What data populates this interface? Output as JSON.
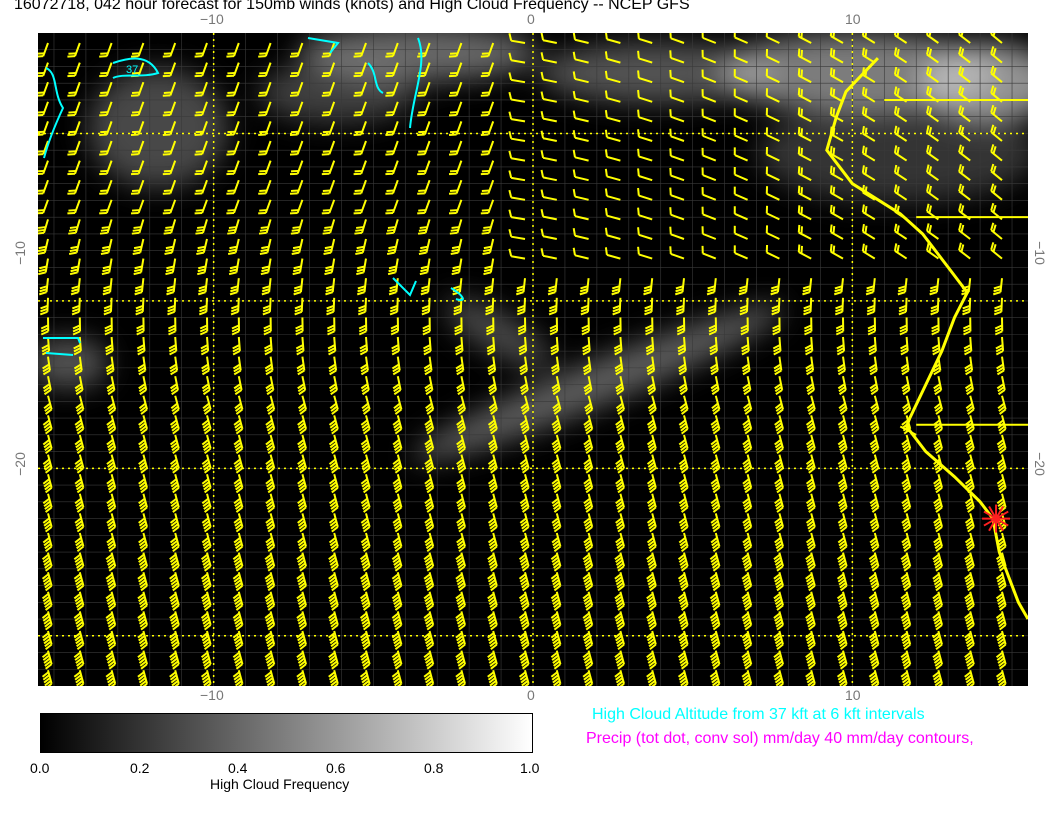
{
  "title": "16072718, 042 hour forecast for 150mb winds (knots) and High Cloud Frequency -- NCEP GFS",
  "map": {
    "lon_range": [
      -15.5,
      15.5
    ],
    "lat_range": [
      -33,
      6
    ],
    "lon_ticks": [
      "−10",
      "0",
      "10"
    ],
    "lat_ticks": [
      "−10",
      "−20"
    ],
    "contour_label": "37",
    "colors": {
      "wind_barbs": "#ffff00",
      "coastline": "#ffff00",
      "cloud_altitude": "#00ffff",
      "precip": "#ff00ff",
      "marker": "#ff2020",
      "graticule": "#ffff00"
    },
    "marker_icon": "star-burst-icon"
  },
  "colorbar": {
    "label": "High Cloud Frequency",
    "ticks": [
      "0.0",
      "0.2",
      "0.4",
      "0.6",
      "0.8",
      "1.0"
    ]
  },
  "legend": {
    "cloud_altitude": "High Cloud Altitude from 37 kft at 6 kft intervals",
    "precip": "Precip (tot dot, conv sol) mm/day 40 mm/day contours,"
  }
}
